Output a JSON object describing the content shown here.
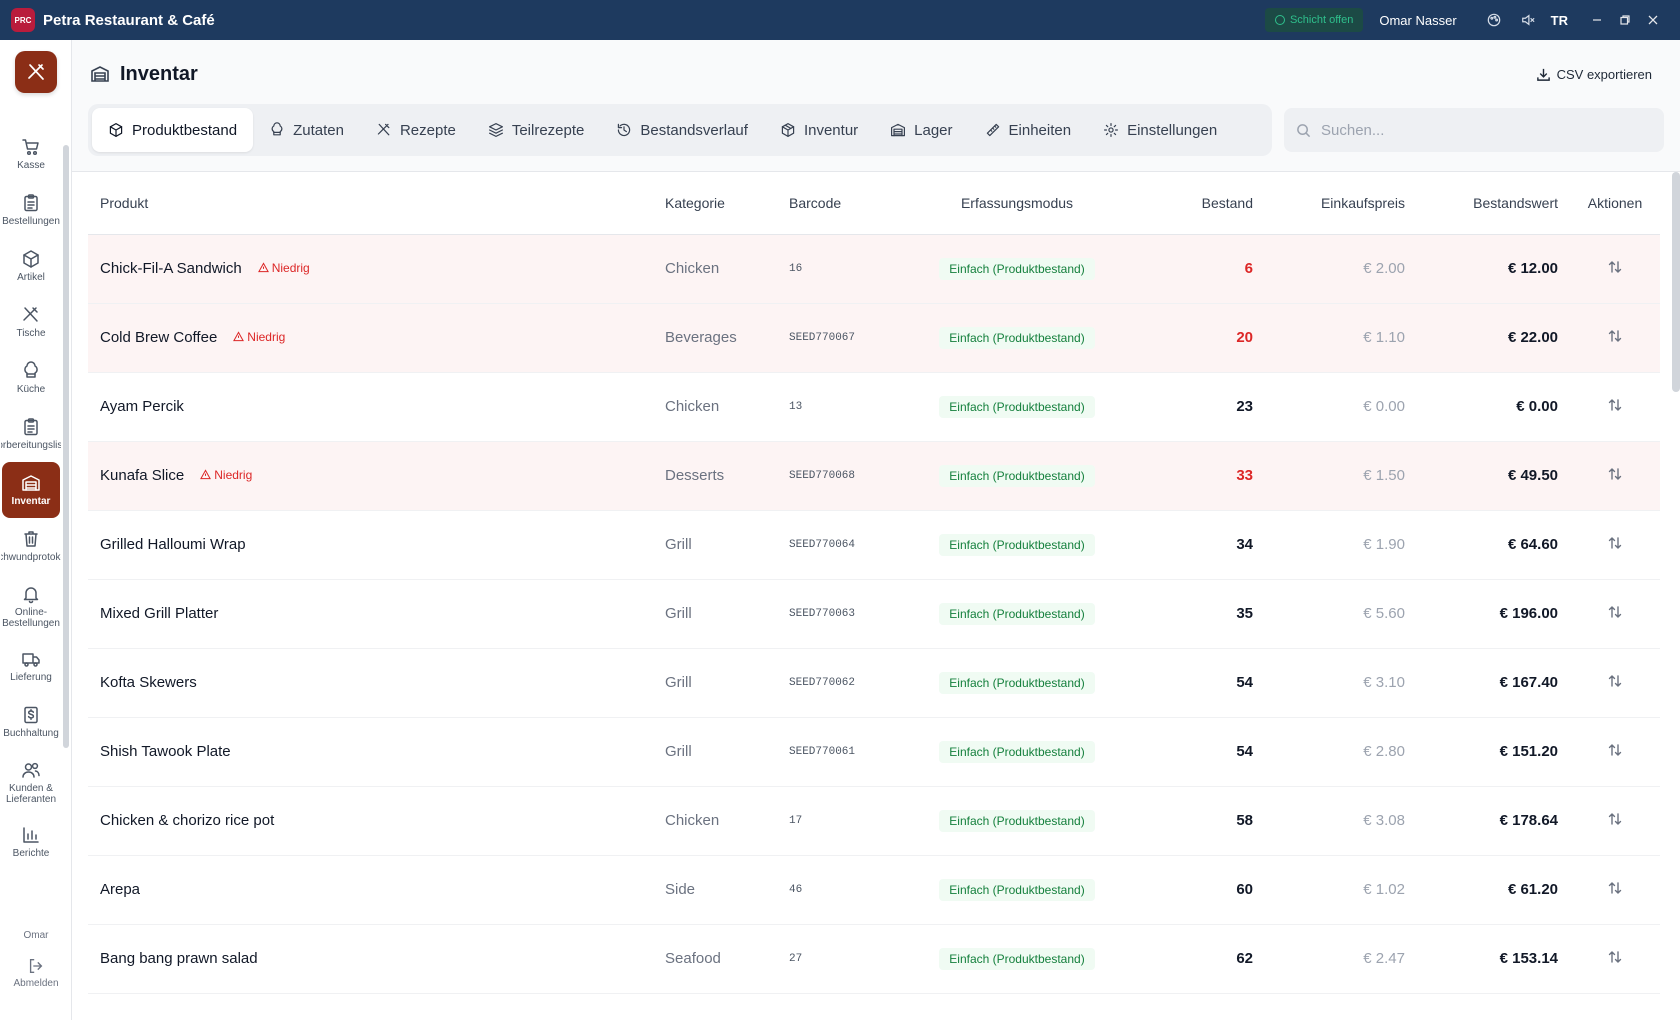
{
  "app": {
    "title": "Petra Restaurant & Café",
    "logo_text": "PRC",
    "shift_status": "Schicht offen",
    "user_name": "Omar Nasser",
    "language": "TR"
  },
  "sidebar": {
    "items": [
      {
        "label": "Kasse",
        "icon": "cart-icon"
      },
      {
        "label": "Bestellungen",
        "icon": "clipboard-icon"
      },
      {
        "label": "Artikel",
        "icon": "box-icon"
      },
      {
        "label": "Tische",
        "icon": "utensils-icon"
      },
      {
        "label": "Küche",
        "icon": "chef-hat-icon"
      },
      {
        "label": "Vorbereitungsliste",
        "icon": "clipboard-list-icon"
      },
      {
        "label": "Inventar",
        "icon": "warehouse-icon",
        "active": true
      },
      {
        "label": "Schwundprotokoll",
        "icon": "trash-icon"
      },
      {
        "label": "Online-\nBestellungen",
        "icon": "bell-icon"
      },
      {
        "label": "Lieferung",
        "icon": "truck-icon"
      },
      {
        "label": "Buchhaltung",
        "icon": "dollar-file-icon"
      },
      {
        "label": "Kunden &\nLieferanten",
        "icon": "users-icon"
      },
      {
        "label": "Berichte",
        "icon": "bar-chart-icon"
      }
    ],
    "user_short": "Omar",
    "logout_label": "Abmelden"
  },
  "page": {
    "title": "Inventar",
    "export_label": "CSV exportieren",
    "search_placeholder": "Suchen..."
  },
  "tabs": [
    {
      "label": "Produktbestand",
      "icon": "box-icon",
      "active": true
    },
    {
      "label": "Zutaten",
      "icon": "chef-hat-icon"
    },
    {
      "label": "Rezepte",
      "icon": "utensils-icon"
    },
    {
      "label": "Teilrezepte",
      "icon": "layers-icon"
    },
    {
      "label": "Bestandsverlauf",
      "icon": "history-icon"
    },
    {
      "label": "Inventur",
      "icon": "package-icon"
    },
    {
      "label": "Lager",
      "icon": "warehouse-icon"
    },
    {
      "label": "Einheiten",
      "icon": "ruler-icon"
    },
    {
      "label": "Einstellungen",
      "icon": "gear-icon"
    }
  ],
  "table": {
    "columns": {
      "product": "Produkt",
      "category": "Kategorie",
      "barcode": "Barcode",
      "mode": "Erfassungsmodus",
      "stock": "Bestand",
      "purchase_price": "Einkaufspreis",
      "stock_value": "Bestandswert",
      "actions": "Aktionen"
    },
    "low_label": "Niedrig",
    "rows": [
      {
        "name": "Chick-Fil-A Sandwich",
        "low": true,
        "category": "Chicken",
        "barcode": "16",
        "mode": "Einfach (Produktbestand)",
        "stock": "6",
        "price": "€ 2.00",
        "value": "€ 12.00"
      },
      {
        "name": "Cold Brew Coffee",
        "low": true,
        "category": "Beverages",
        "barcode": "SEED770067",
        "mode": "Einfach (Produktbestand)",
        "stock": "20",
        "price": "€ 1.10",
        "value": "€ 22.00"
      },
      {
        "name": "Ayam Percik",
        "low": false,
        "category": "Chicken",
        "barcode": "13",
        "mode": "Einfach (Produktbestand)",
        "stock": "23",
        "price": "€ 0.00",
        "value": "€ 0.00"
      },
      {
        "name": "Kunafa Slice",
        "low": true,
        "category": "Desserts",
        "barcode": "SEED770068",
        "mode": "Einfach (Produktbestand)",
        "stock": "33",
        "price": "€ 1.50",
        "value": "€ 49.50"
      },
      {
        "name": "Grilled Halloumi Wrap",
        "low": false,
        "category": "Grill",
        "barcode": "SEED770064",
        "mode": "Einfach (Produktbestand)",
        "stock": "34",
        "price": "€ 1.90",
        "value": "€ 64.60"
      },
      {
        "name": "Mixed Grill Platter",
        "low": false,
        "category": "Grill",
        "barcode": "SEED770063",
        "mode": "Einfach (Produktbestand)",
        "stock": "35",
        "price": "€ 5.60",
        "value": "€ 196.00"
      },
      {
        "name": "Kofta Skewers",
        "low": false,
        "category": "Grill",
        "barcode": "SEED770062",
        "mode": "Einfach (Produktbestand)",
        "stock": "54",
        "price": "€ 3.10",
        "value": "€ 167.40"
      },
      {
        "name": "Shish Tawook Plate",
        "low": false,
        "category": "Grill",
        "barcode": "SEED770061",
        "mode": "Einfach (Produktbestand)",
        "stock": "54",
        "price": "€ 2.80",
        "value": "€ 151.20"
      },
      {
        "name": "Chicken & chorizo rice pot",
        "low": false,
        "category": "Chicken",
        "barcode": "17",
        "mode": "Einfach (Produktbestand)",
        "stock": "58",
        "price": "€ 3.08",
        "value": "€ 178.64"
      },
      {
        "name": "Arepa",
        "low": false,
        "category": "Side",
        "barcode": "46",
        "mode": "Einfach (Produktbestand)",
        "stock": "60",
        "price": "€ 1.02",
        "value": "€ 61.20"
      },
      {
        "name": "Bang bang prawn salad",
        "low": false,
        "category": "Seafood",
        "barcode": "27",
        "mode": "Einfach (Produktbestand)",
        "stock": "62",
        "price": "€ 2.47",
        "value": "€ 153.14"
      }
    ]
  },
  "colors": {
    "titlebar": "#1e3a5f",
    "accent": "#8b2e16",
    "low_stock": "#dc2626",
    "mode_green": "#15803d"
  }
}
